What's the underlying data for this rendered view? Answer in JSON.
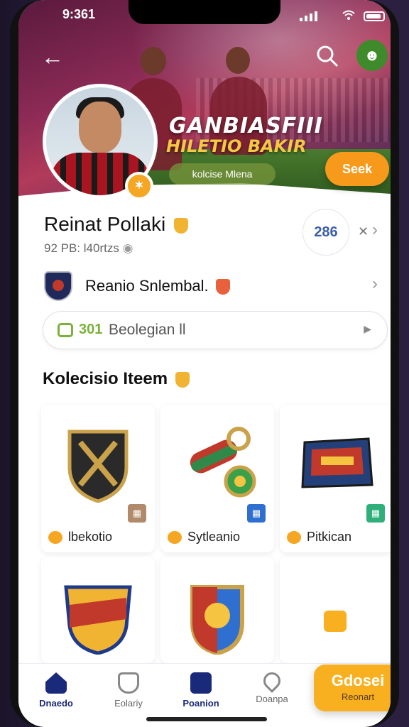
{
  "status_bar": {
    "time": "9:361"
  },
  "hero": {
    "title": "GANBIASFIII",
    "subtitle": "HILETIO BAKIR",
    "pill_label": "kolcise Mlena",
    "action_button": "Seek"
  },
  "profile": {
    "name": "Reinat Pollaki",
    "meta": "92 PB: l40rtzs",
    "count": "286",
    "team_name": "Reanio Snlembal."
  },
  "search_pill": {
    "number": "301",
    "text": "Beolegian ll"
  },
  "section": {
    "title": "Kolecisio Iteem"
  },
  "items": [
    {
      "label": "lbekotio",
      "tag_color": "#b08a6a"
    },
    {
      "label": "Sytleanio",
      "tag_color": "#2f6fd0"
    },
    {
      "label": "Pitkican",
      "tag_color": "#2fb07a"
    },
    {
      "label": "",
      "tag_color": ""
    },
    {
      "label": "",
      "tag_color": ""
    },
    {
      "label": "",
      "tag_color": ""
    }
  ],
  "nav": {
    "items": [
      {
        "label": "Dnaedo"
      },
      {
        "label": "Eolariy"
      },
      {
        "label": "Poanion"
      },
      {
        "label": "Doanpa"
      }
    ],
    "cta_title": "Gdosei",
    "cta_sub": "Reonart"
  },
  "colors": {
    "accent": "#f79a1c",
    "primary": "#1a2a7a",
    "green": "#7ab13a"
  }
}
